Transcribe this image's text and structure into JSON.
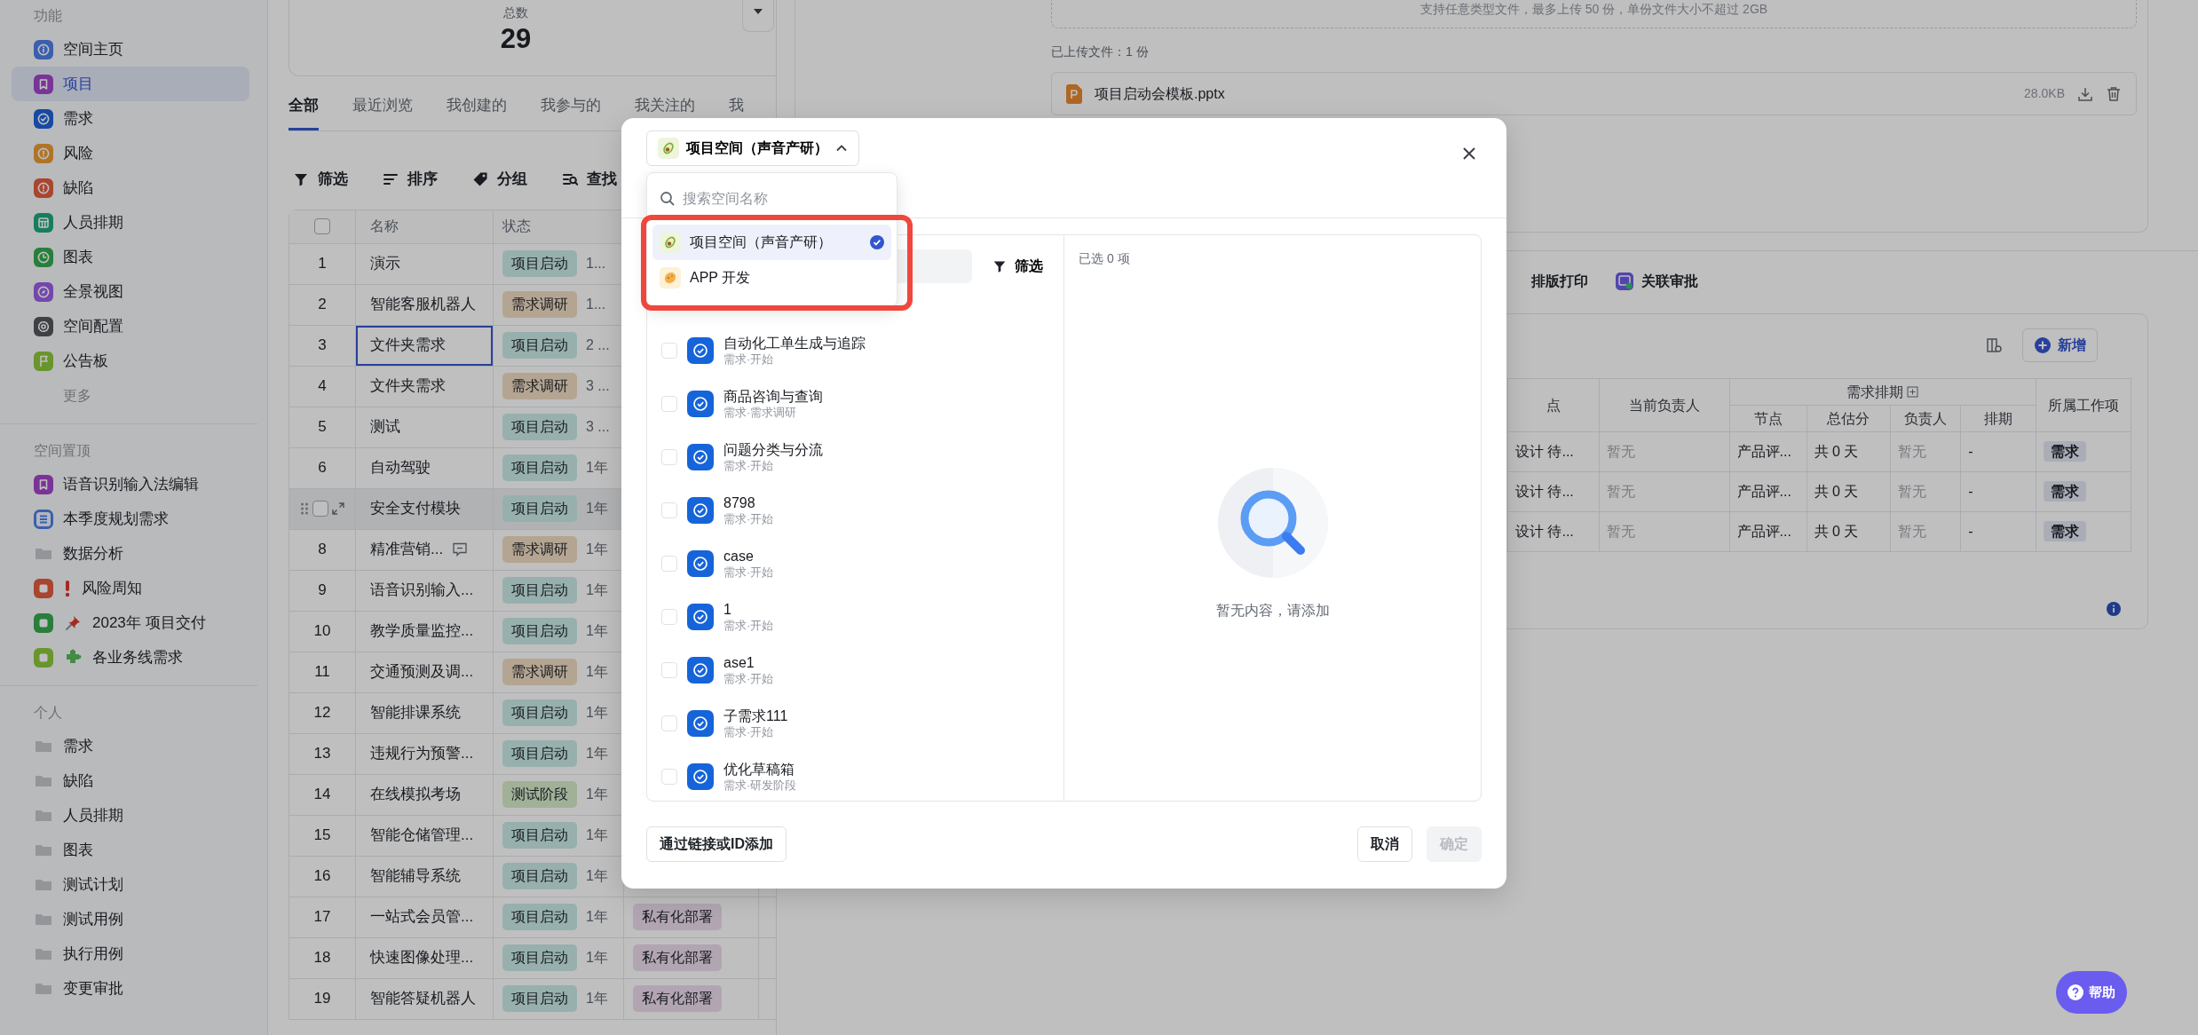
{
  "sidebar": {
    "sections": [
      {
        "title": "功能",
        "items": [
          {
            "label": "空间主页",
            "kind": "info",
            "color": "#3b5fae",
            "selected": false
          },
          {
            "label": "项目",
            "kind": "bookmark",
            "color": "#7a3497",
            "selected": true
          },
          {
            "label": "需求",
            "kind": "check",
            "color": "#164aa2",
            "selected": false
          },
          {
            "label": "风险",
            "kind": "warn",
            "color": "#b07429",
            "selected": false
          },
          {
            "label": "缺陷",
            "kind": "warn",
            "color": "#aa452f",
            "selected": false
          },
          {
            "label": "人员排期",
            "kind": "grid",
            "color": "#177d5d",
            "selected": false
          },
          {
            "label": "图表",
            "kind": "clock",
            "color": "#287f3b",
            "selected": false
          },
          {
            "label": "全景视图",
            "kind": "compass",
            "color": "#7447ad",
            "selected": false
          },
          {
            "label": "空间配置",
            "kind": "gear",
            "color": "#3f4145",
            "selected": false
          },
          {
            "label": "公告板",
            "kind": "flag",
            "color": "#69952d",
            "selected": false
          }
        ],
        "more": "更多"
      },
      {
        "title": "空间置顶",
        "items": [
          {
            "label": "语音识别输入法编辑",
            "kind": "bookmark",
            "color": "#7a3497",
            "selected": false
          },
          {
            "label": "本季度规划需求",
            "kind": "list",
            "color": "#3b5fae",
            "selected": false
          },
          {
            "label": "数据分析",
            "kind": "folder",
            "selected": false
          },
          {
            "label": "风险周知",
            "kind": "exclamation",
            "color": "#aa452f",
            "selected": false
          },
          {
            "label": "2023年 项目交付",
            "kind": "pin",
            "color": "#287f3b",
            "selected": false
          },
          {
            "label": "各业务线需求",
            "kind": "puzzle",
            "color": "#69952d",
            "selected": false
          }
        ]
      },
      {
        "title": "个人",
        "items": [
          {
            "label": "需求",
            "kind": "folder",
            "selected": false
          },
          {
            "label": "缺陷",
            "kind": "folder",
            "selected": false
          },
          {
            "label": "人员排期",
            "kind": "folder",
            "selected": false
          },
          {
            "label": "图表",
            "kind": "folder",
            "selected": false
          },
          {
            "label": "测试计划",
            "kind": "folder",
            "selected": false
          },
          {
            "label": "测试用例",
            "kind": "folder",
            "selected": false
          },
          {
            "label": "执行用例",
            "kind": "folder",
            "selected": false
          },
          {
            "label": "变更审批",
            "kind": "folder",
            "selected": false
          }
        ]
      }
    ]
  },
  "summary": {
    "label": "总数",
    "value": "29"
  },
  "view_tabs": [
    {
      "label": "全部",
      "selected": true
    },
    {
      "label": "最近浏览",
      "selected": false
    },
    {
      "label": "我创建的",
      "selected": false
    },
    {
      "label": "我参与的",
      "selected": false
    },
    {
      "label": "我关注的",
      "selected": false
    },
    {
      "label": "我",
      "selected": false
    }
  ],
  "toolbar": [
    {
      "label": "筛选",
      "kind": "filter"
    },
    {
      "label": "排序",
      "kind": "sort"
    },
    {
      "label": "分组",
      "kind": "group"
    },
    {
      "label": "查找",
      "kind": "find"
    }
  ],
  "table": {
    "columns": [
      "名称",
      "状态"
    ],
    "all_selected": false,
    "rows": [
      {
        "index": "1",
        "name": "演示",
        "status": {
          "text": "项目启动",
          "color": "#97b0ad"
        },
        "time": "1...",
        "selected": false,
        "hovered": false,
        "comment": false
      },
      {
        "index": "2",
        "name": "智能客服机器人",
        "status": {
          "text": "需求调研",
          "color": "#b4a592"
        },
        "time": "1...",
        "selected": false,
        "hovered": false,
        "comment": false
      },
      {
        "index": "3",
        "name": "文件夹需求",
        "status": {
          "text": "项目启动",
          "color": "#97b0ad"
        },
        "time": "2 ...",
        "selected": true,
        "hovered": false,
        "comment": false
      },
      {
        "index": "4",
        "name": "文件夹需求",
        "status": {
          "text": "需求调研",
          "color": "#b4a592"
        },
        "time": "3 ...",
        "selected": false,
        "hovered": false,
        "comment": false
      },
      {
        "index": "5",
        "name": "测试",
        "status": {
          "text": "项目启动",
          "color": "#97b0ad"
        },
        "time": "3 ...",
        "selected": false,
        "hovered": false,
        "comment": false
      },
      {
        "index": "6",
        "name": "自动驾驶",
        "status": {
          "text": "项目启动",
          "color": "#97b0ad"
        },
        "time": "1年",
        "selected": false,
        "hovered": false,
        "comment": false
      },
      {
        "name": "安全支付模块",
        "status": {
          "text": "项目启动",
          "color": "#97b0ad"
        },
        "time": "1年",
        "selected": false,
        "hovered": true,
        "comment": false
      },
      {
        "index": "8",
        "name": "精准营销...",
        "status": {
          "text": "需求调研",
          "color": "#b4a592"
        },
        "time": "1年",
        "selected": false,
        "hovered": false,
        "comment": true
      },
      {
        "index": "9",
        "name": "语音识别输入...",
        "status": {
          "text": "项目启动",
          "color": "#97b0ad"
        },
        "time": "1年",
        "selected": false,
        "hovered": false,
        "comment": false
      },
      {
        "index": "10",
        "name": "教学质量监控...",
        "status": {
          "text": "项目启动",
          "color": "#97b0ad"
        },
        "time": "1年",
        "selected": false,
        "hovered": false,
        "comment": false
      },
      {
        "index": "11",
        "name": "交通预测及调...",
        "status": {
          "text": "需求调研",
          "color": "#b4a592"
        },
        "time": "1年",
        "selected": false,
        "hovered": false,
        "comment": false
      },
      {
        "index": "12",
        "name": "智能排课系统",
        "status": {
          "text": "项目启动",
          "color": "#97b0ad"
        },
        "time": "1年",
        "selected": false,
        "hovered": false,
        "comment": false
      },
      {
        "index": "13",
        "name": "违规行为预警...",
        "status": {
          "text": "项目启动",
          "color": "#97b0ad"
        },
        "time": "1年",
        "selected": false,
        "hovered": false,
        "comment": false
      },
      {
        "index": "14",
        "name": "在线模拟考场",
        "status": {
          "text": "测试阶段",
          "color": "#a0b197"
        },
        "time": "1年",
        "selected": false,
        "hovered": false,
        "comment": false
      },
      {
        "index": "15",
        "name": "智能仓储管理...",
        "status": {
          "text": "项目启动",
          "color": "#97b0ad"
        },
        "time": "1年",
        "selected": false,
        "hovered": false,
        "comment": false
      },
      {
        "index": "16",
        "name": "智能辅导系统",
        "status": {
          "text": "项目启动",
          "color": "#97b0ad"
        },
        "time": "1年",
        "selected": false,
        "hovered": false,
        "comment": false
      },
      {
        "index": "17",
        "name": "一站式会员管...",
        "status": {
          "text": "项目启动",
          "color": "#97b0ad"
        },
        "time": "1年",
        "tag": "私有化部署",
        "selected": false,
        "hovered": false,
        "comment": false
      },
      {
        "index": "18",
        "name": "快速图像处理...",
        "status": {
          "text": "项目启动",
          "color": "#97b0ad"
        },
        "time": "1年",
        "tag": "私有化部署",
        "selected": false,
        "hovered": false,
        "comment": false
      },
      {
        "index": "19",
        "name": "智能答疑机器人",
        "status": {
          "text": "项目启动",
          "color": "#97b0ad"
        },
        "time": "1年",
        "tag": "私有化部署",
        "selected": false,
        "hovered": false,
        "comment": false
      }
    ]
  },
  "attachments": {
    "hint": "支持任意类型文件，最多上传 50 份，单份文件大小不超过 2GB",
    "count_label": "已上传文件：1 份",
    "files": [
      {
        "name": "项目启动会模板.pptx",
        "size": "28.0KB"
      }
    ]
  },
  "actions": [
    {
      "label": "排版打印",
      "kind": "text"
    },
    {
      "label": "关联审批",
      "kind": "approval"
    }
  ],
  "work_items": {
    "add_label": "新增",
    "columns": [
      "点",
      "当前负责人"
    ],
    "group": {
      "label": "需求排期",
      "columns": [
        "节点",
        "总估分",
        "负责人",
        "排期"
      ]
    },
    "last_column": "所属工作项",
    "rows": [
      {
        "node": "设计 待...",
        "owner": "暂无",
        "plan_node": "产品评...",
        "estimate": "共 0 天",
        "assignee": "暂无",
        "schedule": "-",
        "item_type": "需求"
      },
      {
        "node": "设计 待...",
        "owner": "暂无",
        "plan_node": "产品评...",
        "estimate": "共 0 天",
        "assignee": "暂无",
        "schedule": "-",
        "item_type": "需求"
      },
      {
        "node": "设计 待...",
        "owner": "暂无",
        "plan_node": "产品评...",
        "estimate": "共 0 天",
        "assignee": "暂无",
        "schedule": "-",
        "item_type": "需求"
      }
    ]
  },
  "dialog": {
    "space_select": {
      "value": "项目空间（声音产研）",
      "expanded": true
    },
    "filter_label": "筛选",
    "candidates": [
      {
        "title": "自动化工单生成与追踪",
        "subtitle": "需求·开始",
        "checked": false
      },
      {
        "title": "商品咨询与查询",
        "subtitle": "需求·需求调研",
        "checked": false
      },
      {
        "title": "问题分类与分流",
        "subtitle": "需求·开始",
        "checked": false
      },
      {
        "title": "8798",
        "subtitle": "需求·开始",
        "checked": false
      },
      {
        "title": "case",
        "subtitle": "需求·开始",
        "checked": false
      },
      {
        "title": "1",
        "subtitle": "需求·开始",
        "checked": false
      },
      {
        "title": "ase1",
        "subtitle": "需求·开始",
        "checked": false
      },
      {
        "title": "子需求111",
        "subtitle": "需求·开始",
        "checked": false
      },
      {
        "title": "优化草稿箱",
        "subtitle": "需求·研发阶段",
        "checked": false
      }
    ],
    "selected_summary": "已选 0 项",
    "empty_text": "暂无内容，请添加",
    "link_button": "通过链接或ID添加",
    "cancel": "取消",
    "confirm": {
      "label": "确定",
      "disabled": true
    }
  },
  "space_dropdown": {
    "placeholder": "搜索空间名称",
    "highlighted": true,
    "options": [
      {
        "label": "项目空间（声音产研）",
        "kind": "avocado",
        "selected": true
      },
      {
        "label": "APP 开发",
        "kind": "cookie",
        "selected": false
      }
    ]
  },
  "help_button": "帮助"
}
